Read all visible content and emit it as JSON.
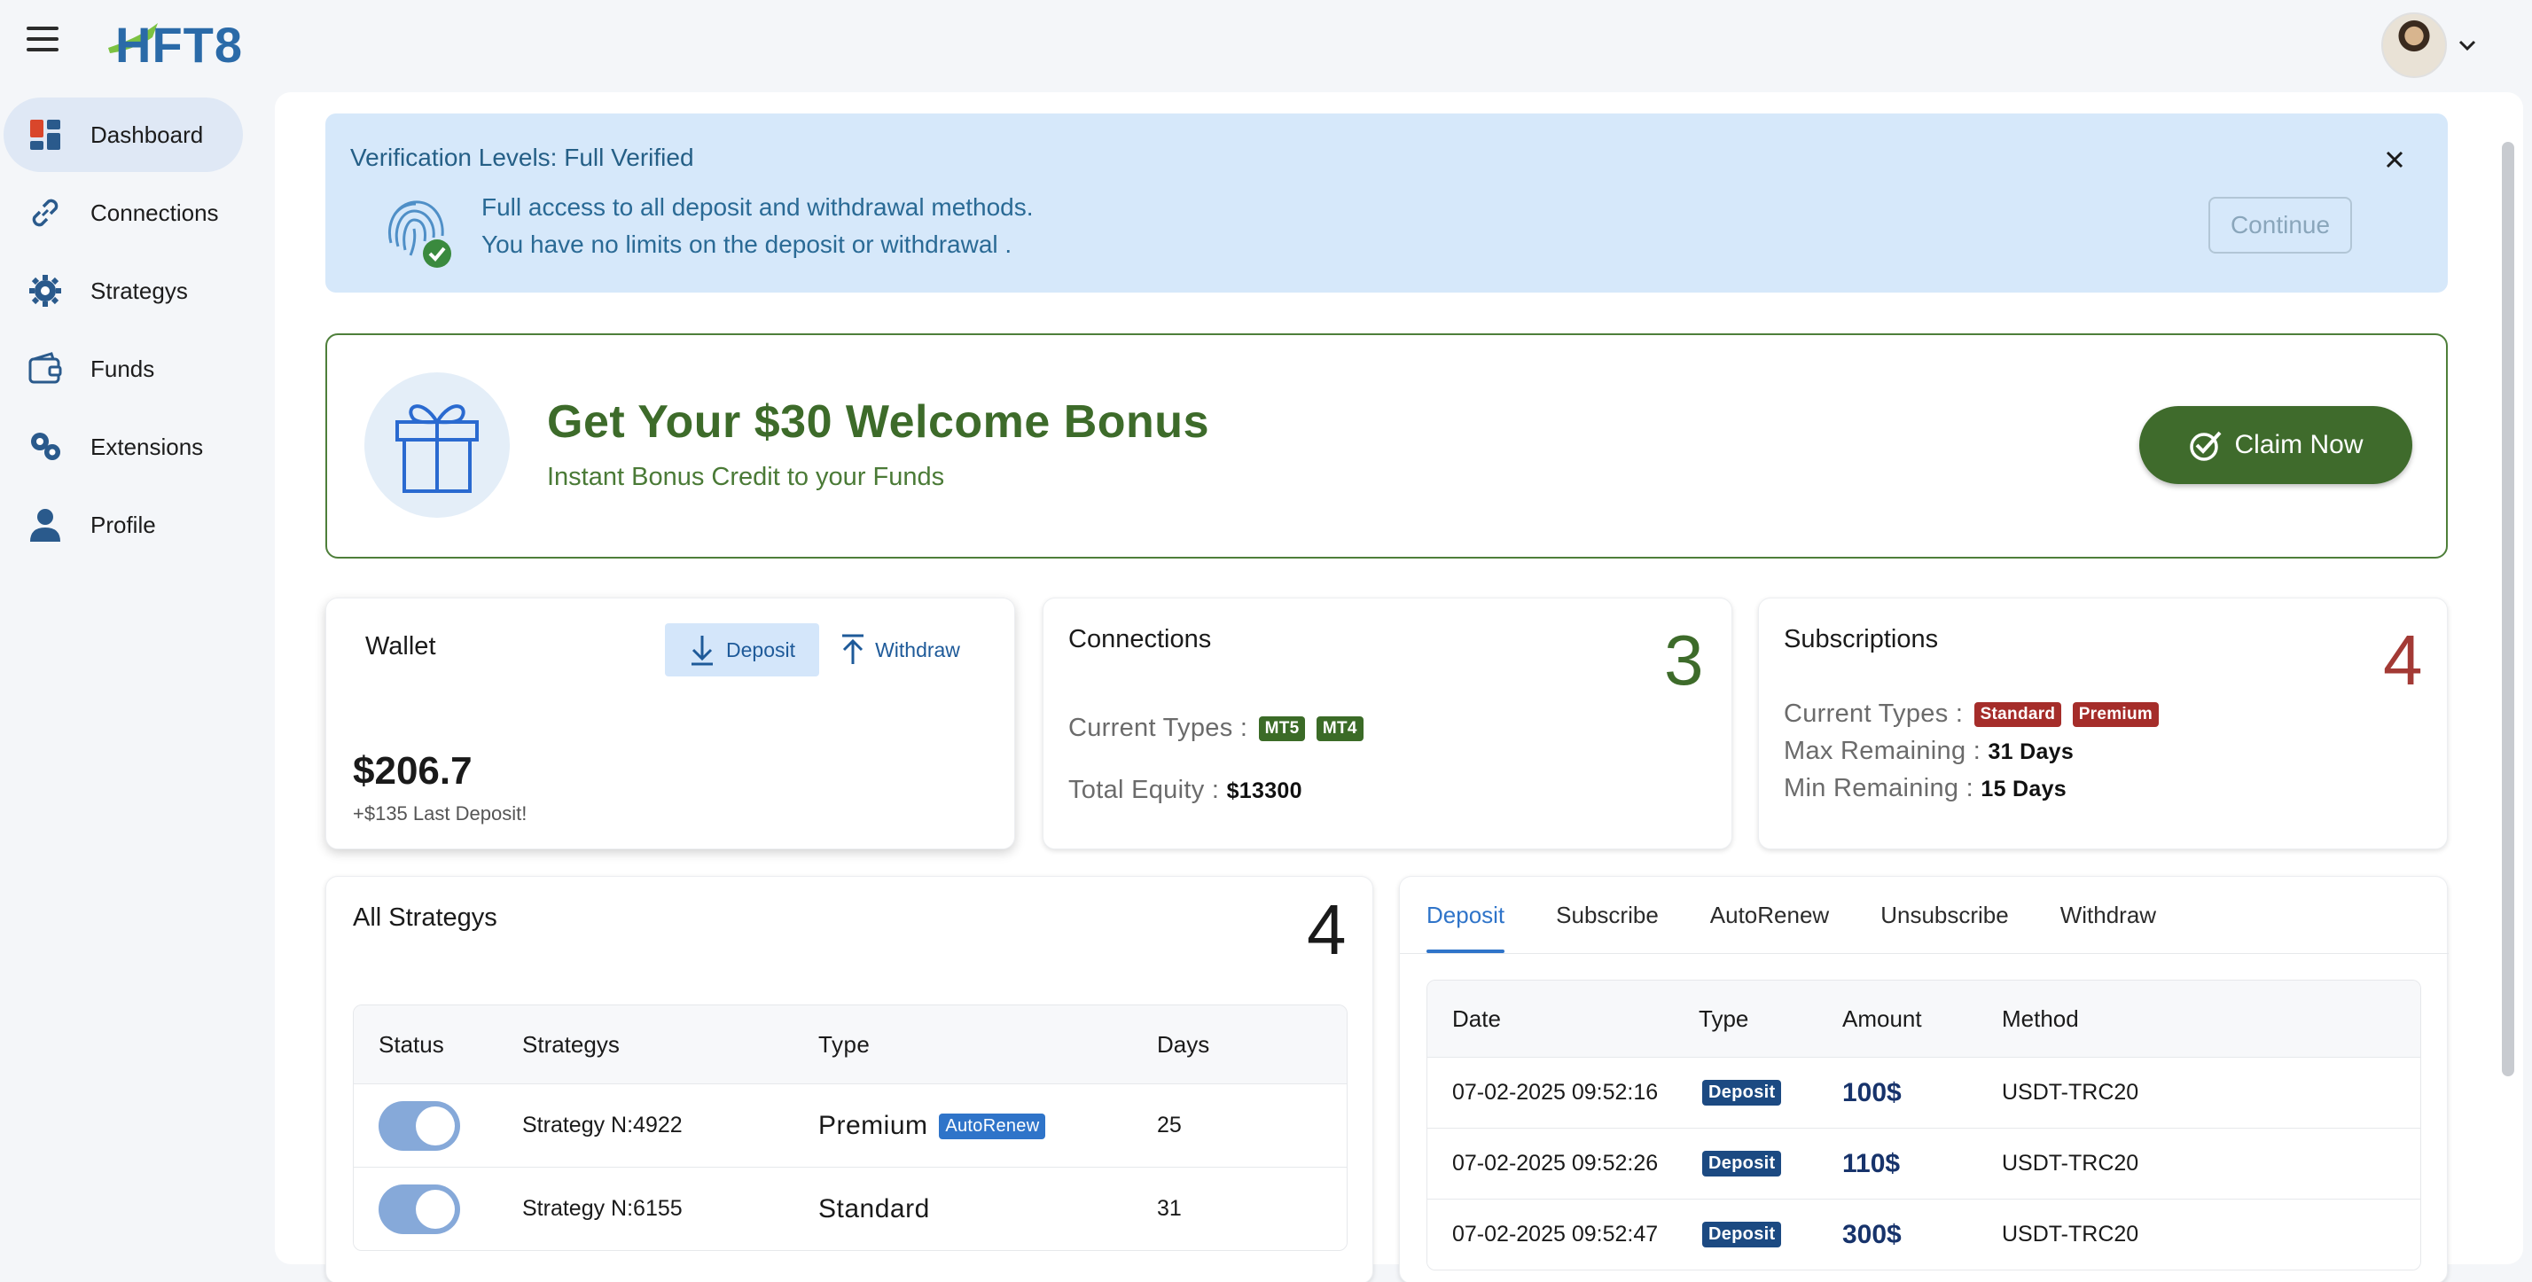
{
  "topbar": {
    "menu_icon": "hamburger-menu-icon",
    "logo_text": "HFT8",
    "avatar_icon": "user-avatar"
  },
  "sidebar": {
    "items": [
      {
        "label": "Dashboard",
        "icon": "dashboard-icon",
        "active": true
      },
      {
        "label": "Connections",
        "icon": "link-icon"
      },
      {
        "label": "Strategys",
        "icon": "gear-strategy-icon"
      },
      {
        "label": "Funds",
        "icon": "wallet-icon"
      },
      {
        "label": "Extensions",
        "icon": "puzzle-icon"
      },
      {
        "label": "Profile",
        "icon": "person-icon"
      }
    ]
  },
  "verification": {
    "title": "Verification Levels: Full Verified",
    "line1": "Full access to all deposit and withdrawal methods.",
    "line2": "You have no limits on the deposit or withdrawal .",
    "continue_label": "Continue"
  },
  "bonus": {
    "title": "Get Your $30 Welcome Bonus",
    "subtitle": "Instant Bonus Credit to your Funds",
    "claim_label": "Claim Now"
  },
  "wallet": {
    "title": "Wallet",
    "deposit_label": "Deposit",
    "withdraw_label": "Withdraw",
    "balance": "$206.7",
    "last_deposit": "+$135 Last Deposit!"
  },
  "connections": {
    "title": "Connections",
    "count": "3",
    "types_label": "Current Types :",
    "types": [
      "MT5",
      "MT4"
    ],
    "equity_label": "Total Equity :",
    "equity_value": "$13300"
  },
  "subscriptions": {
    "title": "Subscriptions",
    "count": "4",
    "types_label": "Current Types :",
    "types": [
      "Standard",
      "Premium"
    ],
    "max_label": "Max Remaining :",
    "max_value": "31 Days",
    "min_label": "Min Remaining :",
    "min_value": "15 Days"
  },
  "strategies": {
    "title": "All Strategys",
    "count": "4",
    "headers": [
      "Status",
      "Strategys",
      "Type",
      "Days"
    ],
    "rows": [
      {
        "name": "Strategy N:4922",
        "type": "Premium",
        "badge": "AutoRenew",
        "days": "25",
        "enabled": true
      },
      {
        "name": "Strategy N:6155",
        "type": "Standard",
        "badge": "",
        "days": "31",
        "enabled": true
      }
    ]
  },
  "transactions": {
    "tabs": [
      "Deposit",
      "Subscribe",
      "AutoRenew",
      "Unsubscribe",
      "Withdraw"
    ],
    "active_tab": "Deposit",
    "headers": [
      "Date",
      "Type",
      "Amount",
      "Method"
    ],
    "rows": [
      {
        "date": "07-02-2025 09:52:16",
        "type": "Deposit",
        "amount": "100$",
        "method": "USDT-TRC20"
      },
      {
        "date": "07-02-2025 09:52:26",
        "type": "Deposit",
        "amount": "110$",
        "method": "USDT-TRC20"
      },
      {
        "date": "07-02-2025 09:52:47",
        "type": "Deposit",
        "amount": "300$",
        "method": "USDT-TRC20"
      }
    ]
  },
  "colors": {
    "accent_blue": "#2f74c9",
    "bonus_green": "#3f6b2c",
    "subs_red": "#a33a35",
    "verify_bg": "#d6e8fa"
  }
}
